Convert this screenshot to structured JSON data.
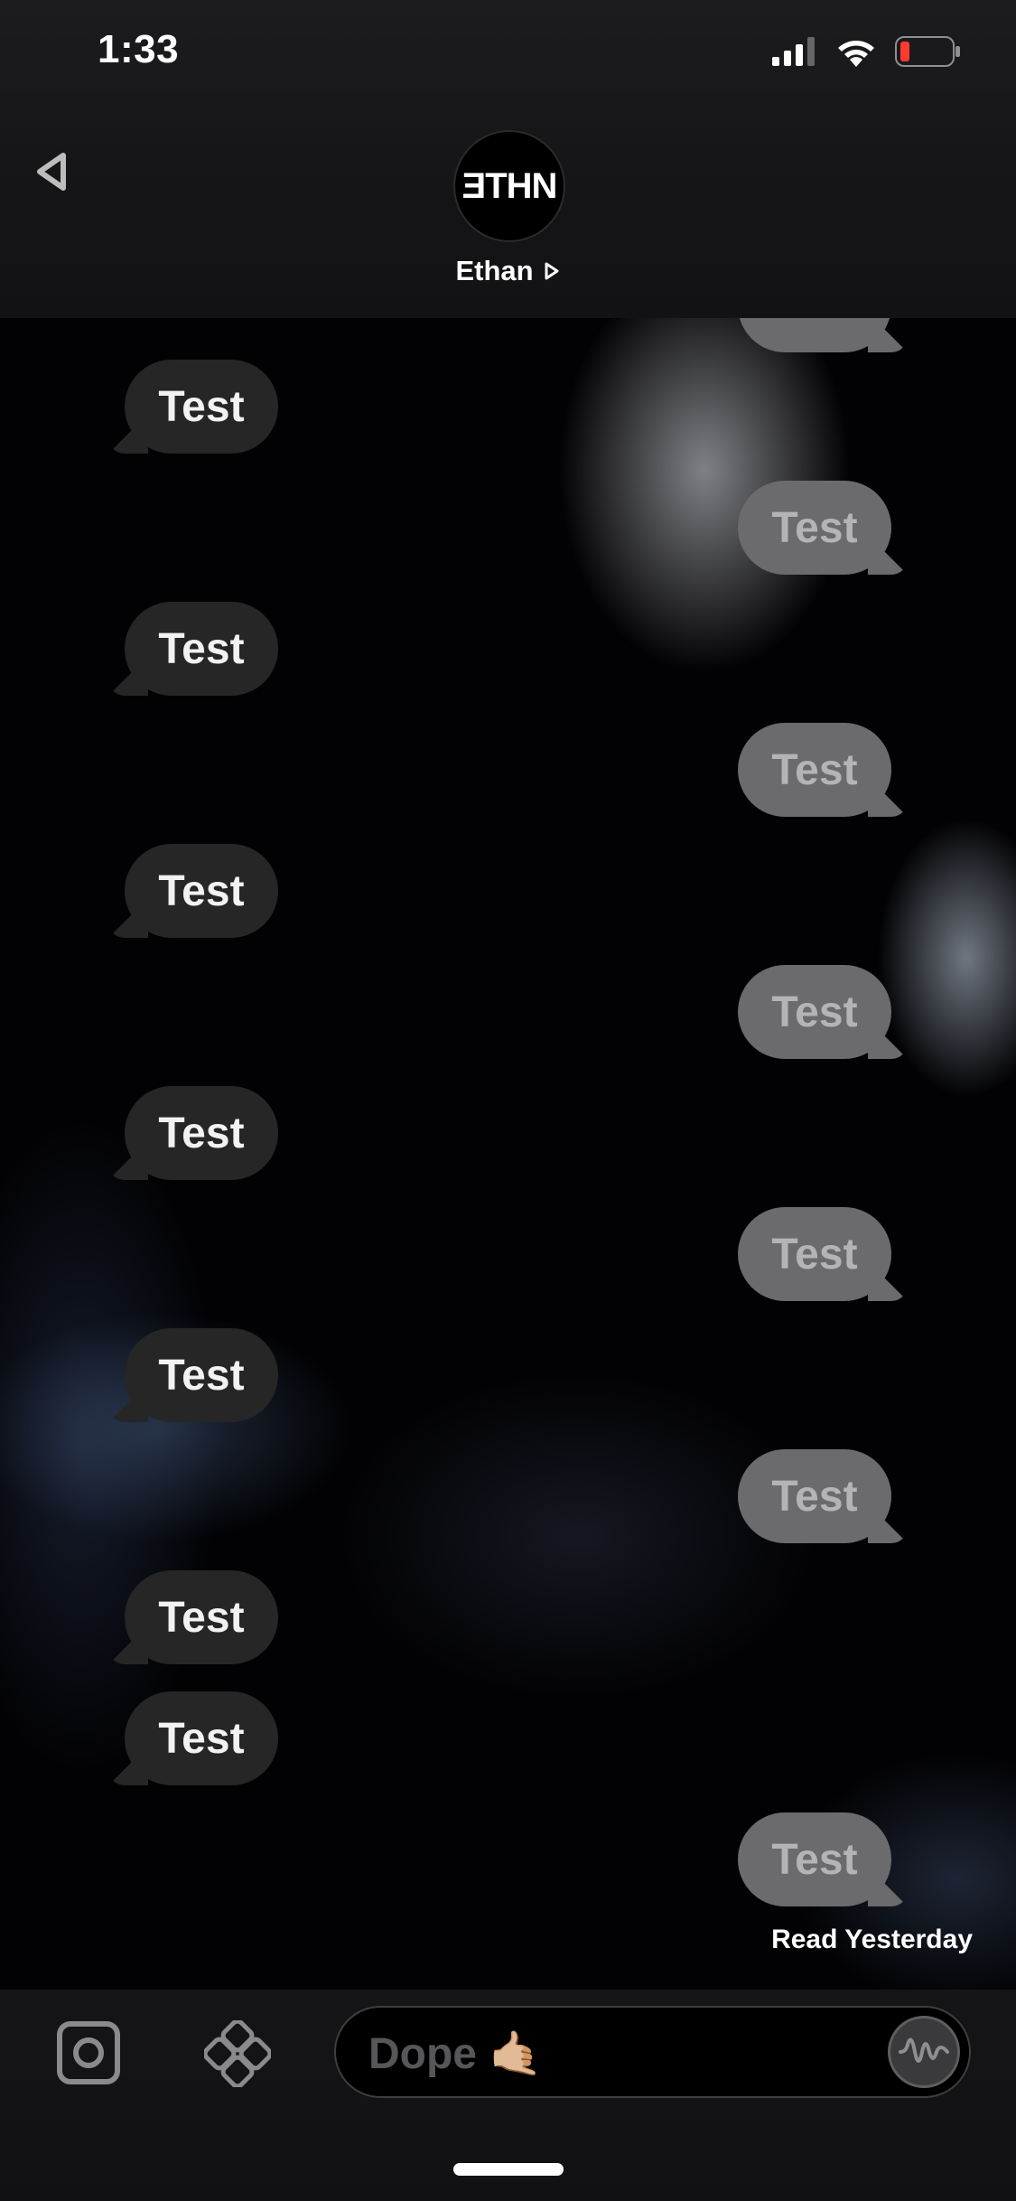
{
  "status_bar": {
    "time": "1:33"
  },
  "header": {
    "avatar_text": "ƎTHN",
    "contact_name": "Ethan"
  },
  "messages": [
    {
      "direction": "in",
      "text": "Test"
    },
    {
      "direction": "out",
      "text": "Test"
    },
    {
      "direction": "in",
      "text": "Test"
    },
    {
      "direction": "out",
      "text": "Test"
    },
    {
      "direction": "in",
      "text": "Test"
    },
    {
      "direction": "out",
      "text": "Test"
    },
    {
      "direction": "in",
      "text": "Test"
    },
    {
      "direction": "out",
      "text": "Test"
    },
    {
      "direction": "in",
      "text": "Test"
    },
    {
      "direction": "out",
      "text": "Test"
    },
    {
      "direction": "in",
      "text": "Test"
    },
    {
      "direction": "in",
      "text": "Test"
    },
    {
      "direction": "out",
      "text": "Test"
    }
  ],
  "read_receipt": "Read Yesterday",
  "composer": {
    "placeholder": "Dope 🤙🏼"
  },
  "colors": {
    "incoming_bubble": "#262627",
    "outgoing_bubble": "#6b6b6d",
    "battery_low": "#ff3b30"
  },
  "icons": {
    "back": "back-arrow-icon",
    "camera": "camera-icon",
    "apps": "apps-icon",
    "audio": "audio-wave-icon"
  }
}
